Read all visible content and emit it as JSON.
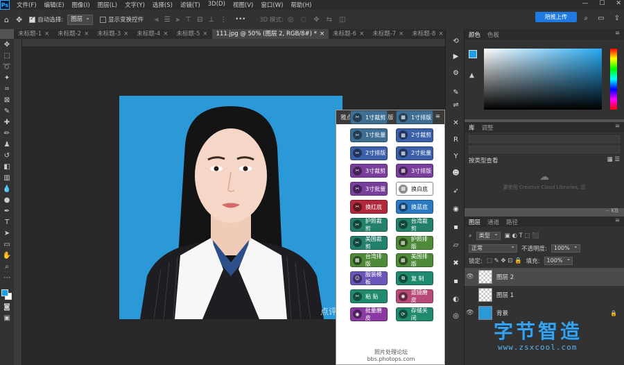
{
  "app": {
    "logo": "Ps"
  },
  "menu": [
    "文件(F)",
    "编辑(E)",
    "图像(I)",
    "图层(L)",
    "文字(Y)",
    "选择(S)",
    "滤镜(T)",
    "3D(D)",
    "视图(V)",
    "窗口(W)",
    "帮助(H)"
  ],
  "window_controls": {
    "minimize": "—",
    "maximize": "☐",
    "close": "✕"
  },
  "options": {
    "auto_select_label": "自动选择:",
    "auto_select_value": "图层",
    "show_transform_label": "显示变换控件",
    "mode3d_label": "3D 模式:",
    "more": "•••",
    "cloud_button": "陪推上传"
  },
  "tabs": [
    {
      "label": "未标题-1",
      "close": "×"
    },
    {
      "label": "未标题-2",
      "close": "×"
    },
    {
      "label": "未标题-3",
      "close": "×"
    },
    {
      "label": "未标题-4",
      "close": "×"
    },
    {
      "label": "未标题-5",
      "close": "×"
    },
    {
      "label": "111.jpg @ 50% (图层 2, RGB/8#) *",
      "close": "×"
    },
    {
      "label": "未标题-6",
      "close": "×"
    },
    {
      "label": "未标题-7",
      "close": "×"
    },
    {
      "label": "未标题-8",
      "close": "×"
    }
  ],
  "photo_watermark": "点评",
  "plugin": {
    "title": "雅点证照大师完整版",
    "buttons": [
      {
        "label": "1寸裁剪",
        "color": "#3e6f93"
      },
      {
        "label": "1寸排版",
        "color": "#3e6f93"
      },
      {
        "label": "1寸批量",
        "color": "#3e6f93"
      },
      {
        "label": "2寸裁剪",
        "color": "#3b5fa8"
      },
      {
        "label": "2寸排版",
        "color": "#3b5fa8"
      },
      {
        "label": "2寸批量",
        "color": "#3b5fa8"
      },
      {
        "label": "3寸裁剪",
        "color": "#7a3f9c"
      },
      {
        "label": "3寸排版",
        "color": "#7a3f9c"
      },
      {
        "label": "3寸批量",
        "color": "#7a3f9c"
      },
      {
        "label": "换白底",
        "color": "#ffffff"
      },
      {
        "label": "换红底",
        "color": "#b02839"
      },
      {
        "label": "换蓝底",
        "color": "#2a79c2"
      },
      {
        "label": "护照裁剪",
        "color": "#23806b"
      },
      {
        "label": "台湾裁剪",
        "color": "#23806b"
      },
      {
        "label": "美国裁剪",
        "color": "#23806b"
      },
      {
        "label": "护照排版",
        "color": "#4f8a3a"
      },
      {
        "label": "台湾排版",
        "color": "#4f8a3a"
      },
      {
        "label": "美国排版",
        "color": "#4f8a3a"
      },
      {
        "label": "服装模板",
        "color": "#6a55b8"
      },
      {
        "label": "复 制",
        "color": "#1f8a6d"
      },
      {
        "label": "粘 贴",
        "color": "#1f8a6d"
      },
      {
        "label": "滤镜磨皮",
        "color": "#b84a78"
      },
      {
        "label": "批量磨皮",
        "color": "#8a3aa0"
      },
      {
        "label": "存储关闭",
        "color": "#1f8a6d"
      }
    ],
    "footer_line1": "照片处理论坛",
    "footer_line2": "bbs.photops.com"
  },
  "color_panel": {
    "tabs": [
      "颜色",
      "色板"
    ],
    "foreground": "#1aa0e8"
  },
  "library_panel": {
    "tabs": [
      "库",
      "调整"
    ],
    "view_label": "按类型查看",
    "cc_text": "要使用 Creative Cloud Libraries, 您",
    "size_label": "-- KB"
  },
  "layers_panel": {
    "tabs": [
      "图层",
      "通道",
      "路径"
    ],
    "filter_label": "类型",
    "blend_mode": "正常",
    "opacity_label": "不透明度:",
    "opacity_value": "100%",
    "lock_label": "锁定:",
    "fill_label": "填充:",
    "fill_value": "100%",
    "layers": [
      {
        "name": "图层 2",
        "selected": true,
        "visible": true
      },
      {
        "name": "图层 1",
        "selected": false,
        "visible": false
      },
      {
        "name": "背景",
        "selected": false,
        "visible": true,
        "locked": true
      }
    ]
  },
  "site_watermark": {
    "title": "字节智造",
    "url": "www.zsxcool.com"
  }
}
